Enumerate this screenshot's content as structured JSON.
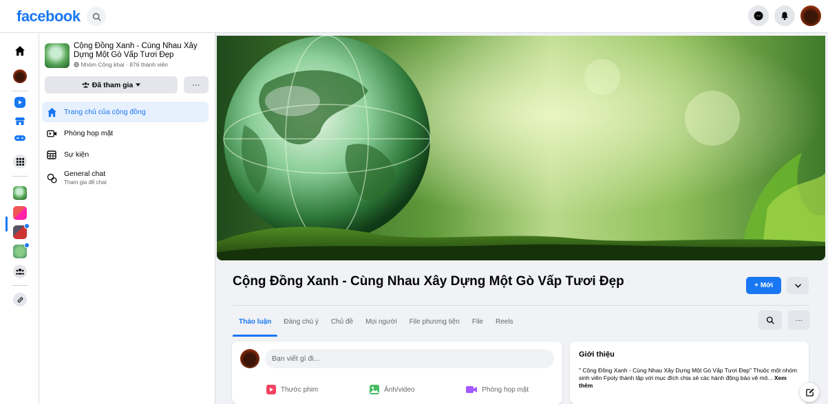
{
  "topbar": {
    "logo": "facebook"
  },
  "group": {
    "name": "Cộng Đồng Xanh - Cùng Nhau Xây Dựng Một Gò Vấp Tươi Đẹp",
    "meta": "Nhóm Công khai · 876 thành viên",
    "joined_label": "Đã tham gia",
    "more_label": "···"
  },
  "sidebar": {
    "items": [
      {
        "label": "Trang chủ của cộng đồng",
        "icon": "home-icon"
      },
      {
        "label": "Phòng họp mặt",
        "icon": "video-room-icon"
      },
      {
        "label": "Sự kiện",
        "icon": "calendar-icon"
      },
      {
        "label": "General chat",
        "sub": "Tham gia để chat",
        "icon": "chat-icon"
      }
    ]
  },
  "main": {
    "title": "Cộng Đồng Xanh - Cùng Nhau Xây Dựng Một Gò Vấp Tươi Đẹp",
    "new_button": "Mới",
    "tabs": [
      "Thảo luận",
      "Đáng chú ý",
      "Chủ đề",
      "Mọi người",
      "File phương tiện",
      "File",
      "Reels"
    ],
    "tab_more": "···"
  },
  "composer": {
    "placeholder": "Bạn viết gì đi...",
    "actions": [
      "Thước phim",
      "Ảnh/video",
      "Phòng họp mặt"
    ]
  },
  "intro": {
    "heading": "Giới thiệu",
    "text": "\" Cộng Đồng Xanh - Cùng Nhau Xây Dựng Một Gò Vấp Tươi Đẹp\" Thuộc một nhóm sinh viên Fpoly thành lập với mục đích chia sẻ các hành động bảo vệ mô...",
    "see_more": "Xem thêm"
  },
  "colors": {
    "brand": "#1877f2",
    "background": "#f0f2f5"
  }
}
